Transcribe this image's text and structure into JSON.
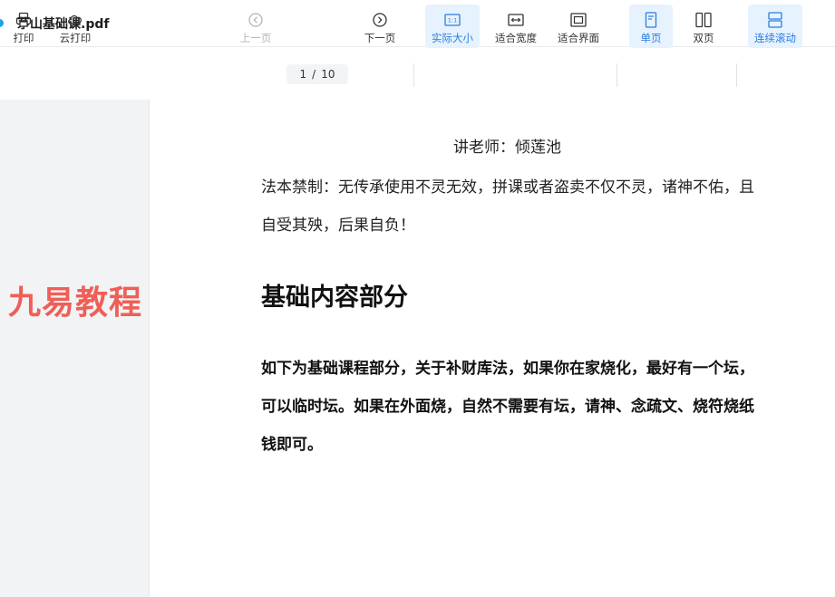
{
  "window": {
    "title": "茅山基础课.pdf"
  },
  "toolbar": {
    "print": "打印",
    "cloud_print": "云打印",
    "prev_page": "上一页",
    "page_current": "1",
    "page_sep": "/",
    "page_total": "10",
    "next_page": "下一页",
    "actual_size": "实际大小",
    "actual_size_icon_text": "1:1",
    "fit_width": "适合宽度",
    "fit_page": "适合界面",
    "single_page": "单页",
    "double_page": "双页",
    "continuous_scroll": "连续滚动",
    "accent_color": "#2b7de0"
  },
  "sidebar": {
    "watermark": "九易教程",
    "watermark_color": "#ee5f57"
  },
  "document": {
    "lecturer": "讲老师：倾莲池",
    "warning": "法本禁制：无传承使用不灵无效，拼课或者盗卖不仅不灵，诸神不佑，且自受其殃，后果自负！",
    "section_title": "基础内容部分",
    "paragraph": "如下为基础课程部分，关于补财库法，如果你在家烧化，最好有一个坛，可以临时坛。如果在外面烧，自然不需要有坛，请神、念疏文、烧符烧纸钱即可。"
  }
}
